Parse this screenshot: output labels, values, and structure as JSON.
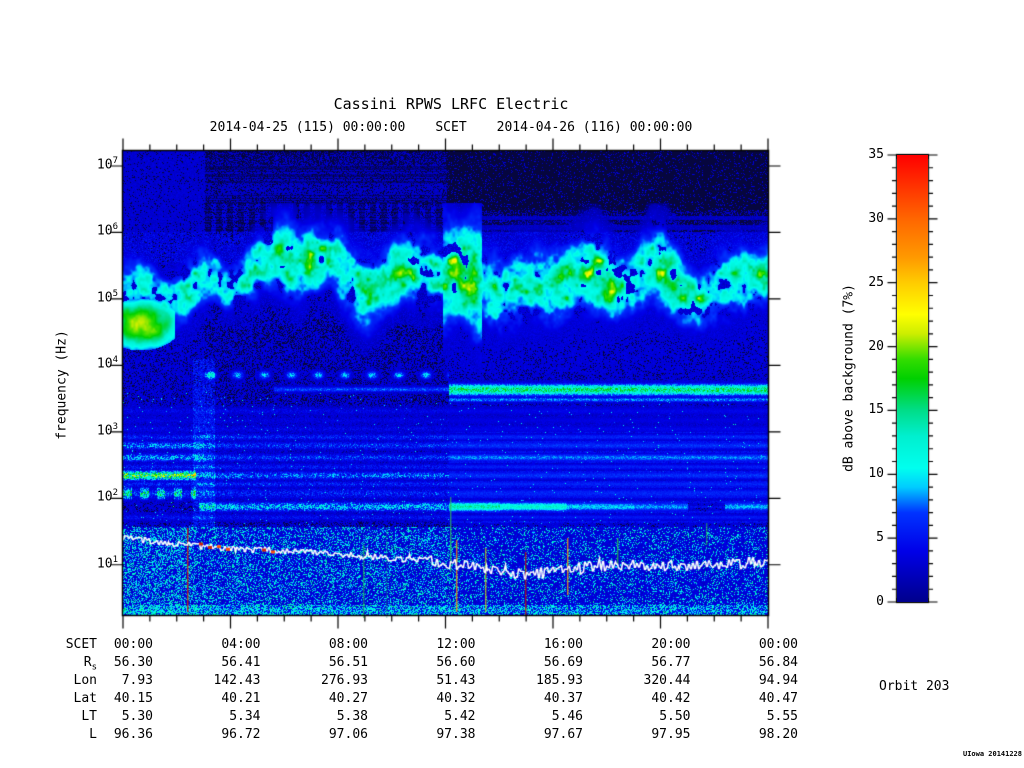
{
  "header": {
    "title": "Cassini RPWS LRFC Electric",
    "start_time": "2014-04-25 (115) 00:00:00",
    "scet_label": "SCET",
    "end_time": "2014-04-26 (116) 00:00:00"
  },
  "annotations": {
    "orbit": "Orbit 203",
    "credit": "UIowa 20141228"
  },
  "y_axis": {
    "label": "frequency (Hz)",
    "tick_base": "10",
    "tick_exponents": [
      7,
      6,
      5,
      4,
      3,
      2,
      1
    ]
  },
  "colorbar": {
    "label": "dB above background (7%)",
    "min": 0,
    "max": 35,
    "major_step": 5,
    "minor_step": 1,
    "tick_labels": [
      "0",
      "5",
      "10",
      "15",
      "20",
      "25",
      "30",
      "35"
    ]
  },
  "ephemeris_table": {
    "rows": [
      {
        "label": "SCET",
        "label_sub": "",
        "values": [
          "00:00",
          "04:00",
          "08:00",
          "12:00",
          "16:00",
          "20:00",
          "00:00"
        ]
      },
      {
        "label": "R",
        "label_sub": "s",
        "values": [
          "56.30",
          "56.41",
          "56.51",
          "56.60",
          "56.69",
          "56.77",
          "56.84"
        ]
      },
      {
        "label": "Lon",
        "label_sub": "",
        "values": [
          "7.93",
          "142.43",
          "276.93",
          "51.43",
          "185.93",
          "320.44",
          "94.94"
        ]
      },
      {
        "label": "Lat",
        "label_sub": "",
        "values": [
          "40.15",
          "40.21",
          "40.27",
          "40.32",
          "40.37",
          "40.42",
          "40.47"
        ]
      },
      {
        "label": "LT",
        "label_sub": "",
        "values": [
          "5.30",
          "5.34",
          "5.38",
          "5.42",
          "5.46",
          "5.50",
          "5.55"
        ]
      },
      {
        "label": "L",
        "label_sub": "",
        "values": [
          "96.36",
          "96.72",
          "97.06",
          "97.38",
          "97.67",
          "97.95",
          "98.20"
        ]
      }
    ]
  },
  "chart_data": {
    "type": "heatmap",
    "title": "Cassini RPWS LRFC Electric",
    "x": {
      "label": "SCET",
      "start": "2014-04-25 (115) 00:00:00",
      "end": "2014-04-26 (116) 00:00:00",
      "hours_span": 24,
      "major_tick_hours": 4,
      "minor_tick_hours": 1,
      "tick_labels": [
        "00:00",
        "04:00",
        "08:00",
        "12:00",
        "16:00",
        "20:00",
        "00:00"
      ]
    },
    "y": {
      "label": "frequency (Hz)",
      "scale": "log",
      "decade_exponents": [
        1,
        2,
        3,
        4,
        5,
        6,
        7
      ]
    },
    "z": {
      "label": "dB above background (7%)",
      "min": 0,
      "max": 35
    },
    "colormap": [
      [
        0,
        0,
        0,
        140
      ],
      [
        4,
        0,
        0,
        232
      ],
      [
        7,
        0,
        51,
        255
      ],
      [
        9,
        0,
        204,
        255
      ],
      [
        10.5,
        0,
        255,
        238
      ],
      [
        13,
        0,
        239,
        207
      ],
      [
        15,
        0,
        221,
        136
      ],
      [
        17.5,
        0,
        208,
        0
      ],
      [
        19,
        51,
        221,
        0
      ],
      [
        21,
        204,
        238,
        0
      ],
      [
        22.5,
        255,
        255,
        0
      ],
      [
        25,
        255,
        204,
        0
      ],
      [
        27,
        255,
        153,
        0
      ],
      [
        30,
        255,
        102,
        0
      ],
      [
        32.5,
        255,
        51,
        0
      ],
      [
        35,
        255,
        0,
        0
      ]
    ],
    "features": [
      "patchy 8-25 dB emission band between ~80 kHz and 1 MHz across the whole day, brightest near 05:30-06:30, 12:00-13:20 and 16:30-21:30",
      "intense 18-24 dB blob at 20-80 kHz during 00:00-01:45",
      "narrowband ~5 kHz line: dotted scallops 03:00-12:00, bright continuous cyan band after 12:00",
      "many horizontal banded emissions between ~50 Hz and 1 kHz all day; yellow-green line near 220 Hz before 02:40; green streak near 80 Hz 12:00-19:00",
      "jagged white trace near 15-30 Hz descending slowly through the day",
      "red/orange/green vertical dropouts below ~100 Hz near 02:20, 09:00, 12:10, 12:25, 13:30, 15:00, 16:30, 18:25",
      "above 1 MHz: bluish noise before 12:00, nearly black with sparse blue dots after 12:00"
    ],
    "render": {
      "seed": 1337,
      "band": {
        "center_base": 5.32,
        "tall": [
          11.9,
          13.35,
          2.0
        ],
        "boosts": [
          [
            5.3,
            6.6,
            3
          ],
          [
            9.3,
            11.2,
            3
          ],
          [
            11.9,
            13.35,
            6
          ],
          [
            16.6,
            19.2,
            4
          ],
          [
            19.6,
            21.8,
            4
          ]
        ]
      },
      "left_blob": {
        "h_center": 0.65,
        "h_r": 1.3,
        "lf_center": 4.62,
        "lf_r": 0.34,
        "amp": 18
      },
      "lines": [
        {
          "lf": 3.86,
          "sigma": 0.05,
          "h0": 2.7,
          "h1": 12.1,
          "amp": 9.5,
          "period": 1.0
        },
        {
          "lf": 3.645,
          "sigma": 0.035,
          "h0": 5.6,
          "h1": 12.1,
          "amp": 7,
          "period": 0
        },
        {
          "lf": 3.64,
          "sigma": 0.065,
          "h0": 12.1,
          "h1": 24,
          "amp": 15,
          "period": 0
        },
        {
          "lf": 3.49,
          "sigma": 0.03,
          "h0": 12.1,
          "h1": 24,
          "amp": 8,
          "period": 0
        }
      ],
      "stripes": [
        {
          "lf": 3.32,
          "sigma": 0.05,
          "segs": [
            [
              0,
              24,
              4.5
            ]
          ]
        },
        {
          "lf": 3.18,
          "sigma": 0.05,
          "segs": [
            [
              0,
              24,
              4.0
            ]
          ]
        },
        {
          "lf": 3.05,
          "sigma": 0.05,
          "segs": [
            [
              0,
              24,
              4.5
            ]
          ]
        },
        {
          "lf": 2.93,
          "sigma": 0.04,
          "segs": [
            [
              0,
              24,
              6.5
            ]
          ]
        },
        {
          "lf": 2.8,
          "sigma": 0.05,
          "segs": [
            [
              0,
              3,
              9
            ],
            [
              3,
              24,
              7
            ]
          ]
        },
        {
          "lf": 2.62,
          "sigma": 0.05,
          "segs": [
            [
              0,
              3,
              9.5
            ],
            [
              3,
              12.1,
              7
            ],
            [
              12.1,
              24,
              8.5
            ]
          ]
        },
        {
          "lf": 2.48,
          "sigma": 0.04,
          "segs": [
            [
              0,
              24,
              6
            ]
          ]
        },
        {
          "lf": 2.35,
          "sigma": 0.05,
          "segs": [
            [
              0,
              2.7,
              20.5
            ],
            [
              2.7,
              12.1,
              8.5
            ],
            [
              12.1,
              24,
              7
            ]
          ]
        },
        {
          "lf": 2.22,
          "sigma": 0.04,
          "segs": [
            [
              0,
              24,
              6.5
            ]
          ]
        },
        {
          "lf": 2.08,
          "sigma": 0.065,
          "segs": [
            [
              0,
              2.7,
              13
            ],
            [
              2.7,
              24,
              6.5
            ]
          ]
        },
        {
          "lf": 1.88,
          "sigma": 0.055,
          "segs": [
            [
              2.8,
              12.1,
              11
            ],
            [
              12.1,
              14,
              15
            ],
            [
              14,
              16.5,
              13
            ],
            [
              16.5,
              19,
              10
            ],
            [
              19,
              21,
              9
            ],
            [
              22.4,
              24,
              9.5
            ]
          ]
        },
        {
          "lf": 1.72,
          "sigma": 0.04,
          "segs": [
            [
              0,
              24,
              5.5
            ]
          ]
        }
      ],
      "verticals": [
        [
          187,
          528,
          612,
          "#cc2200",
          0.85
        ],
        [
          363,
          545,
          618,
          "#22bb44",
          0.6
        ],
        [
          386,
          527,
          618,
          "#119977",
          0.35
        ],
        [
          450,
          497,
          572,
          "#33bb55",
          0.75
        ],
        [
          456,
          540,
          612,
          "#ff8800",
          0.8
        ],
        [
          485,
          548,
          612,
          "#ddcc00",
          0.7
        ],
        [
          525,
          552,
          615,
          "#bb1100",
          0.8
        ],
        [
          567,
          538,
          595,
          "#ff9900",
          0.8
        ],
        [
          617,
          538,
          566,
          "#33cc33",
          0.7
        ],
        [
          706,
          523,
          545,
          "#33cc33",
          0.55
        ]
      ],
      "white_line": {
        "points": [
          [
            0,
            386
          ],
          [
            2,
            393
          ],
          [
            4,
            397
          ],
          [
            7,
            401
          ],
          [
            9,
            405
          ],
          [
            11,
            409
          ],
          [
            13,
            415
          ],
          [
            15,
            423
          ],
          [
            16,
            420
          ],
          [
            18,
            414
          ],
          [
            20,
            415
          ],
          [
            22,
            412
          ],
          [
            24,
            411
          ]
        ],
        "jitter_left": 2.8,
        "jitter_right": 5.5
      }
    }
  }
}
